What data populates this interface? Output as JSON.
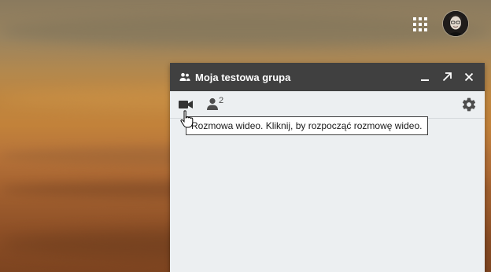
{
  "chat_window": {
    "title": "Moja testowa grupa",
    "header_icons": {
      "group": "group-icon",
      "minimize": "minimize-icon",
      "popout": "popout-icon",
      "close": "close-icon"
    },
    "toolbar": {
      "video_icon": "video-camera-icon",
      "members_icon": "person-icon",
      "members_count": "2",
      "settings_icon": "gear-icon"
    },
    "tooltip": "Rozmowa wideo. Kliknij, by rozpocząć rozmowę wideo."
  },
  "top_bar": {
    "apps_icon": "apps-grid-icon",
    "avatar": "user-avatar"
  },
  "colors": {
    "header_bg": "#404040",
    "panel_bg": "#eceff1",
    "icon_dark": "#4d4d4d"
  }
}
